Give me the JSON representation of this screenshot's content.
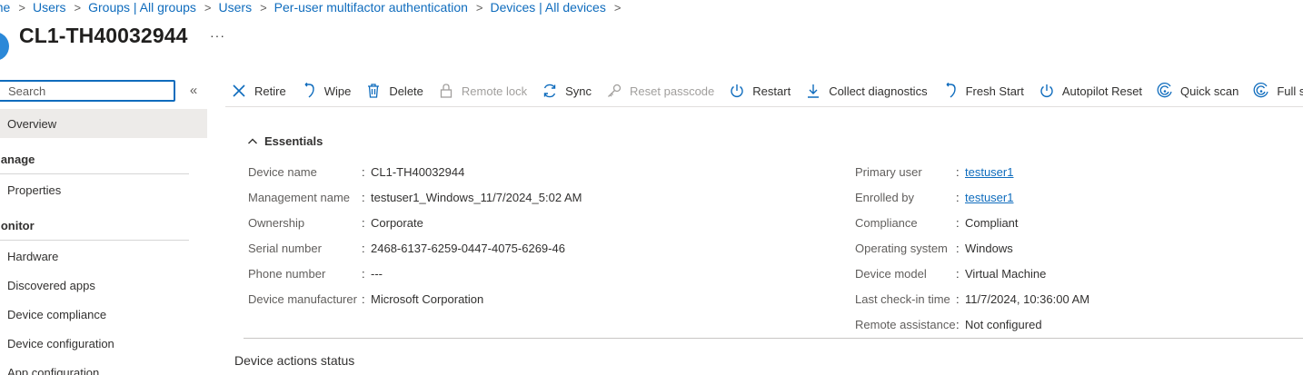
{
  "breadcrumb": [
    "Home",
    "Users",
    "Groups | All groups",
    "Users",
    "Per-user multifactor authentication",
    "Devices | All devices"
  ],
  "header": {
    "title": "CL1-TH40032944",
    "more": "···"
  },
  "sidebar": {
    "search_placeholder": "Search",
    "collapse_glyph": "«",
    "overview": "Overview",
    "manage_header": "Manage",
    "manage_items": [
      "Properties"
    ],
    "monitor_header": "Monitor",
    "monitor_items": [
      "Hardware",
      "Discovered apps",
      "Device compliance",
      "Device configuration",
      "App configuration"
    ]
  },
  "toolbar": {
    "items": [
      {
        "label": "Retire",
        "icon": "close-icon",
        "disabled": false
      },
      {
        "label": "Wipe",
        "icon": "wipe-icon",
        "disabled": false
      },
      {
        "label": "Delete",
        "icon": "trash-icon",
        "disabled": false
      },
      {
        "label": "Remote lock",
        "icon": "lock-icon",
        "disabled": true
      },
      {
        "label": "Sync",
        "icon": "sync-icon",
        "disabled": false
      },
      {
        "label": "Reset passcode",
        "icon": "key-icon",
        "disabled": true
      },
      {
        "label": "Restart",
        "icon": "power-icon",
        "disabled": false
      },
      {
        "label": "Collect diagnostics",
        "icon": "download-icon",
        "disabled": false
      },
      {
        "label": "Fresh Start",
        "icon": "fresh-start-icon",
        "disabled": false
      },
      {
        "label": "Autopilot Reset",
        "icon": "power-icon",
        "disabled": false
      },
      {
        "label": "Quick scan",
        "icon": "scan-icon",
        "disabled": false
      },
      {
        "label": "Full scan",
        "icon": "scan-icon",
        "disabled": false
      }
    ],
    "overflow": "···"
  },
  "essentials": {
    "toggle_label": "Essentials",
    "left": [
      {
        "label": "Device name",
        "value": "CL1-TH40032944"
      },
      {
        "label": "Management name",
        "value": "testuser1_Windows_11/7/2024_5:02 AM"
      },
      {
        "label": "Ownership",
        "value": "Corporate"
      },
      {
        "label": "Serial number",
        "value": "2468-6137-6259-0447-4075-6269-46"
      },
      {
        "label": "Phone number",
        "value": "---"
      },
      {
        "label": "Device manufacturer",
        "value": "Microsoft Corporation"
      }
    ],
    "right": [
      {
        "label": "Primary user",
        "value": "testuser1",
        "link": true
      },
      {
        "label": "Enrolled by",
        "value": "testuser1",
        "link": true
      },
      {
        "label": "Compliance",
        "value": "Compliant"
      },
      {
        "label": "Operating system",
        "value": "Windows"
      },
      {
        "label": "Device model",
        "value": "Virtual Machine"
      },
      {
        "label": "Last check-in time",
        "value": "11/7/2024, 10:36:00 AM"
      },
      {
        "label": "Remote assistance",
        "value": "Not configured"
      }
    ]
  },
  "device_actions_heading": "Device actions status",
  "colors": {
    "accent": "#0f6cbd",
    "text": "#323130",
    "muted": "#605e5c",
    "disabled": "#a19f9d",
    "selected_bg": "#edebe9"
  }
}
